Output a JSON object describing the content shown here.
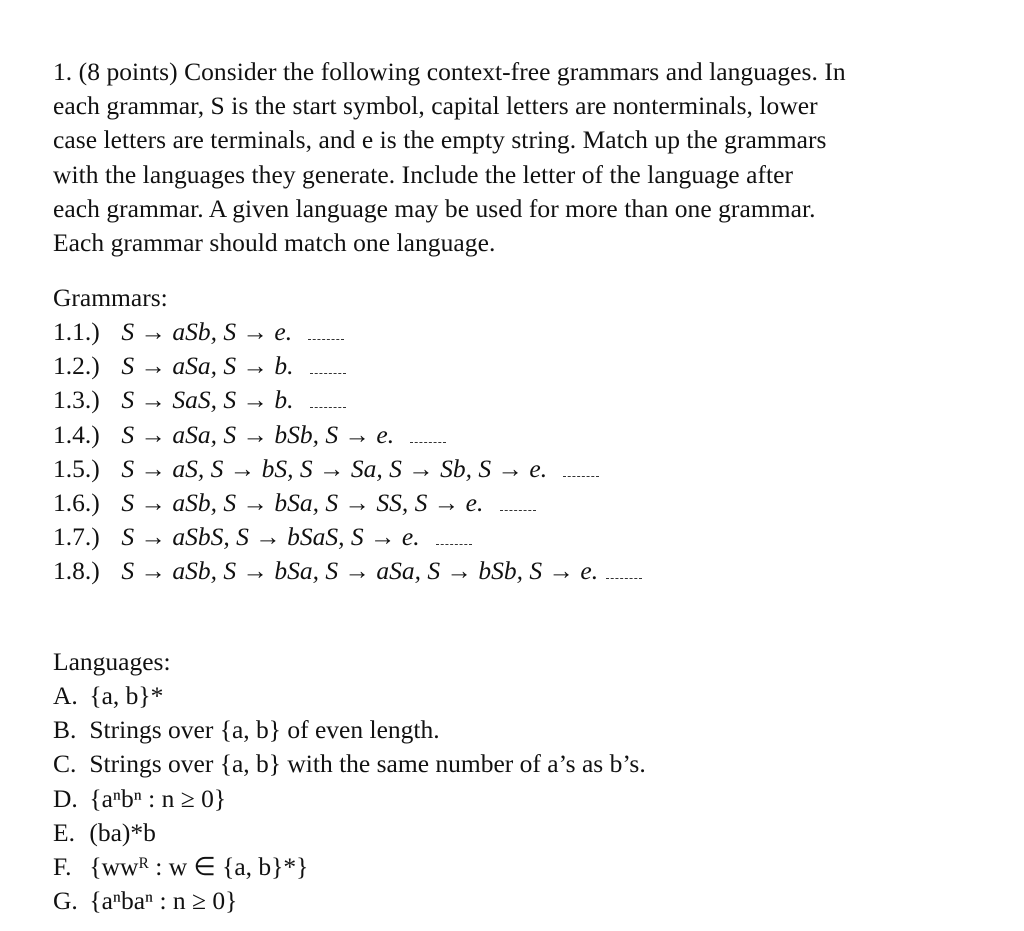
{
  "question": {
    "number": "1.",
    "points": "(8 points)",
    "intro_lines": [
      "Consider the following context-free grammars and languages. In",
      "each grammar, S is the start symbol, capital letters are nonterminals, lower",
      "case letters are terminals, and e is the empty string. Match up the grammars",
      "with the languages they generate. Include the letter of the language after",
      "each grammar. A given language may be used for more than one grammar.",
      "Each grammar should match one language."
    ]
  },
  "grammars": {
    "title": "Grammars:",
    "items": [
      {
        "label": "1.1.)",
        "rules": "S → aSb, S → e.",
        "answer": ""
      },
      {
        "label": "1.2.)",
        "rules": "S → aSa, S → b.",
        "answer": ""
      },
      {
        "label": "1.3.)",
        "rules": "S → SaS, S → b.",
        "answer": ""
      },
      {
        "label": "1.4.)",
        "rules": "S → aSa, S → bSb, S → e.",
        "answer": ""
      },
      {
        "label": "1.5.)",
        "rules": "S → aS, S → bS, S → Sa, S → Sb, S → e.",
        "answer": ""
      },
      {
        "label": "1.6.)",
        "rules": "S → aSb, S → bSa, S → SS, S → e.",
        "answer": ""
      },
      {
        "label": "1.7.)",
        "rules": "S → aSbS, S → bSaS, S → e.",
        "answer": ""
      },
      {
        "label": "1.8.)",
        "rules": "S → aSb, S → bSa, S → aSa, S → bSb, S → e.",
        "answer": ""
      }
    ]
  },
  "languages": {
    "title": "Languages:",
    "items": [
      {
        "letter": "A.",
        "text": "{a, b}*"
      },
      {
        "letter": "B.",
        "text": "Strings over {a, b} of even length."
      },
      {
        "letter": "C.",
        "text": "Strings over {a, b} with the same number of a’s as b’s."
      },
      {
        "letter": "D.",
        "text": "{aⁿbⁿ : n ≥ 0}"
      },
      {
        "letter": "E.",
        "text": "(ba)*b"
      },
      {
        "letter": "F.",
        "text": "{wwᴿ : w ∈ {a, b}*}"
      },
      {
        "letter": "G.",
        "text": "{aⁿbaⁿ : n ≥ 0}"
      }
    ]
  }
}
